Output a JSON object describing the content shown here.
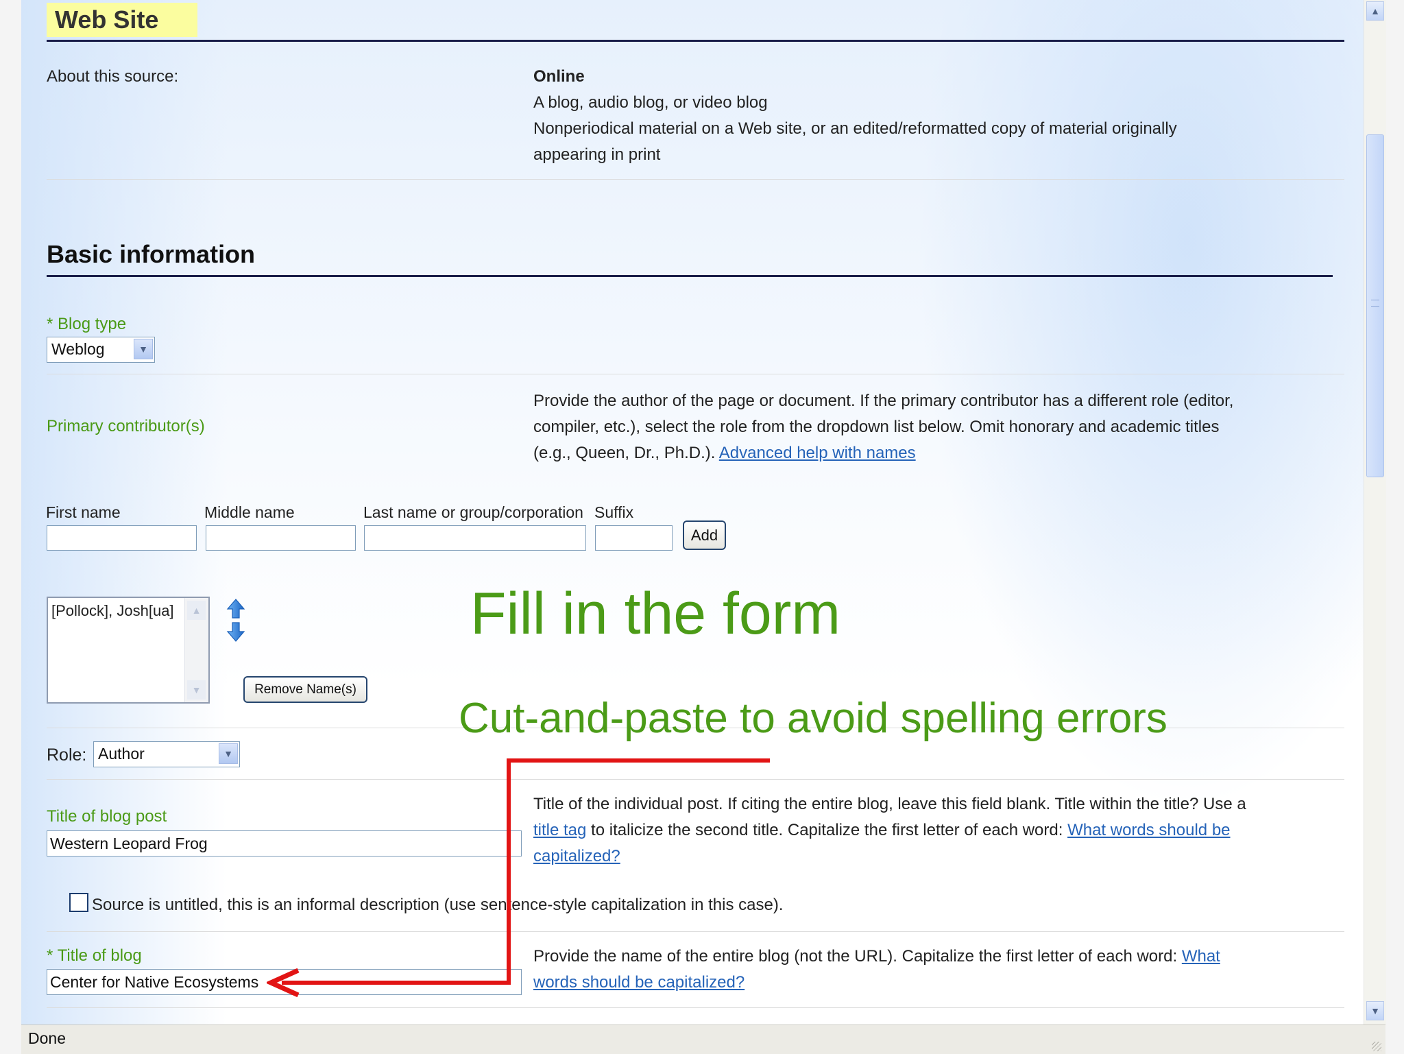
{
  "header": {
    "title": "Web Site"
  },
  "about": {
    "label": "About this source:",
    "heading": "Online",
    "line1": "A blog, audio blog, or video blog",
    "line2": "Nonperiodical material on a Web site, or an edited/reformatted copy of material originally",
    "line3": "appearing in print"
  },
  "basic": {
    "title": "Basic information",
    "blog_type_label": "* Blog type",
    "blog_type_value": "Weblog"
  },
  "contributors": {
    "label": "Primary contributor(s)",
    "help1": "Provide the author of the page or document. If the primary contributor has a different role (editor,",
    "help2": "compiler, etc.), select the role from the dropdown list below. Omit honorary and academic titles",
    "help3": "(e.g., Queen, Dr., Ph.D.).",
    "help_link": "Advanced help with names",
    "first_name_label": "First name",
    "middle_name_label": "Middle name",
    "last_name_label": "Last name or group/corporation",
    "suffix_label": "Suffix",
    "add_button": "Add",
    "list_items": [
      "[Pollock], Josh[ua]"
    ],
    "remove_button": "Remove Name(s)",
    "role_label": "Role:",
    "role_value": "Author"
  },
  "post": {
    "label": "Title of blog post",
    "value": "Western Leopard Frog",
    "help1": "Title of the individual post. If citing the entire blog, leave this field blank. Title within the title? Use a",
    "help2_link": "title tag",
    "help2_text": " to italicize the second title. Capitalize the first letter of each word: ",
    "help2_link2a": "What words should be",
    "help3_link2b": "capitalized?",
    "untitled_label": "Source is untitled, this is an informal description (use sentence-style capitalization in this case)."
  },
  "blog": {
    "label": "* Title of blog",
    "value": "Center for Native Ecosystems",
    "help1_text": "Provide the name of the entire blog (not the URL). Capitalize the first letter of each word: ",
    "help1_link": "What",
    "help2_link": "words should be capitalized?"
  },
  "overlay": {
    "heading": "Fill in the form",
    "subheading": "Cut-and-paste to avoid spelling errors"
  },
  "statusbar": {
    "text": "Done"
  },
  "colors": {
    "label_green": "#4a9a16",
    "overlay_green": "#4b9b17",
    "arrow_red": "#e21414",
    "link_blue": "#2563b8",
    "highlight": "#fbfd9f"
  }
}
